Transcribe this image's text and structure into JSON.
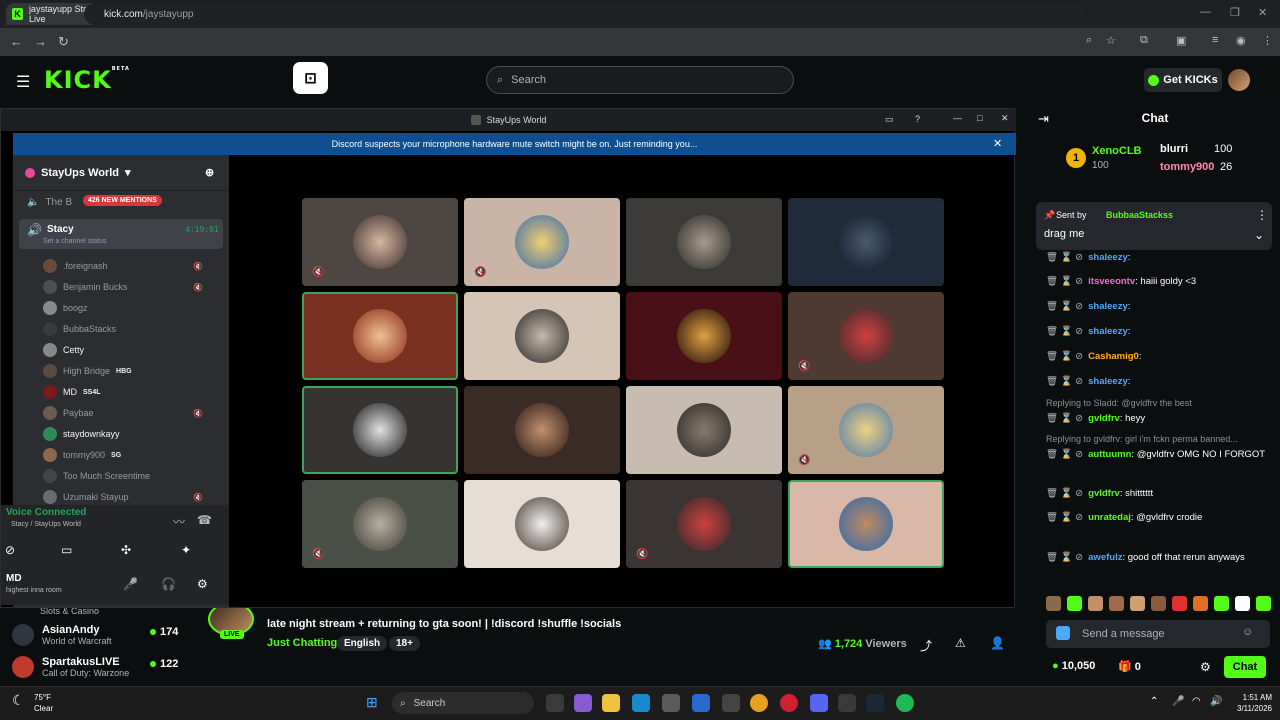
{
  "browser": {
    "tab_title": "jaystayupp Stream - Watch Live",
    "url_host": "kick.com",
    "url_path": "/jaystayupp"
  },
  "kick": {
    "logo": "KICK",
    "logo_sup": "BETA",
    "search_placeholder": "Search",
    "get_kicks": "Get KICKs",
    "sidebar_channels": [
      {
        "name": "Slots & Casino",
        "game": ""
      },
      {
        "name": "AsianAndy",
        "game": "World of Warcraft",
        "viewers": "174"
      },
      {
        "name": "SpartakusLIVE",
        "game": "Call of Duty: Warzone",
        "viewers": "122"
      }
    ],
    "stream": {
      "live_badge": "LIVE",
      "title": "late night stream + returning to gta soon! | !discord !shuffle !socials",
      "category": "Just Chatting",
      "tags": [
        "English",
        "18+"
      ],
      "viewers": "1,724",
      "viewers_label": "Viewers"
    }
  },
  "discord": {
    "window_title": "StayUps World",
    "notice": "Discord suspects your microphone hardware mute switch might be on. Just reminding you...",
    "server_name": "StayUps World",
    "channel_prev": "The B",
    "mentions": "426 NEW MENTIONS",
    "active_channel": "Stacy",
    "active_time": "4:19:01",
    "channel_status": "Set a channel status",
    "users": [
      {
        "name": ".foreignash",
        "badge": ""
      },
      {
        "name": "Benjamin Bucks",
        "badge": ""
      },
      {
        "name": "boogz",
        "badge": ""
      },
      {
        "name": "BubbaStacks",
        "badge": ""
      },
      {
        "name": "Cetty",
        "badge": ""
      },
      {
        "name": "High Bridge",
        "badge": "HBG"
      },
      {
        "name": "MD",
        "badge": "SS4L"
      },
      {
        "name": "Paybae",
        "badge": ""
      },
      {
        "name": "staydownkayy",
        "badge": ""
      },
      {
        "name": "tommy900",
        "badge": "SG"
      },
      {
        "name": "Too Much Screentime",
        "badge": ""
      },
      {
        "name": "Uzumaki Stayup",
        "badge": ""
      }
    ],
    "voice_status": "Voice Connected",
    "voice_channel": "Stacy / StayUps World",
    "me_name": "MD",
    "me_status": "highest inna room"
  },
  "chat": {
    "header": "Chat",
    "leaderboard": [
      {
        "name": "XenoCLB",
        "value": "100"
      },
      {
        "name": "blurri",
        "value": "100"
      },
      {
        "name": "tommy900",
        "value": "26"
      }
    ],
    "leaderboard_rank": "1",
    "leaderboard_sub": "100",
    "pinned_by_label": "Sent by",
    "pinned_by": "BubbaaStackss",
    "pinned_text": "drag me",
    "messages": [
      {
        "user": "shaleezy",
        "text": ""
      },
      {
        "user": "itsveeontv",
        "text": "haiii goldy <3"
      },
      {
        "user": "shaleezy",
        "text": ""
      },
      {
        "user": "shaleezy",
        "text": ""
      },
      {
        "user": "Cashamig0",
        "text": ""
      },
      {
        "user": "shaleezy",
        "text": ""
      },
      {
        "reply": "Replying to Sladd: @gvldfrv the best",
        "user": "gvldfrv",
        "text": "heyy"
      },
      {
        "reply": "Replying to gvldfrv: girl i'm fckn perma banned...",
        "user": "auttuumn",
        "text": "@gvldfrv OMG NO I FORGOT"
      },
      {
        "user": "gvldfrv",
        "text": "shitttttt"
      },
      {
        "user": "unratedaj",
        "text": "@gvldfrv crodie"
      },
      {
        "user": "awefulz",
        "text": "good off that rerun anyways"
      }
    ],
    "send_placeholder": "Send a message",
    "points": "10,050",
    "other_count": "0",
    "chat_button": "Chat",
    "colors": {
      "accent": "#53fc18",
      "user_blue": "#53fc18"
    }
  },
  "taskbar": {
    "temp": "75°F",
    "weather": "Clear",
    "search": "Search",
    "time": "1:51 AM",
    "date": "3/11/2026"
  }
}
